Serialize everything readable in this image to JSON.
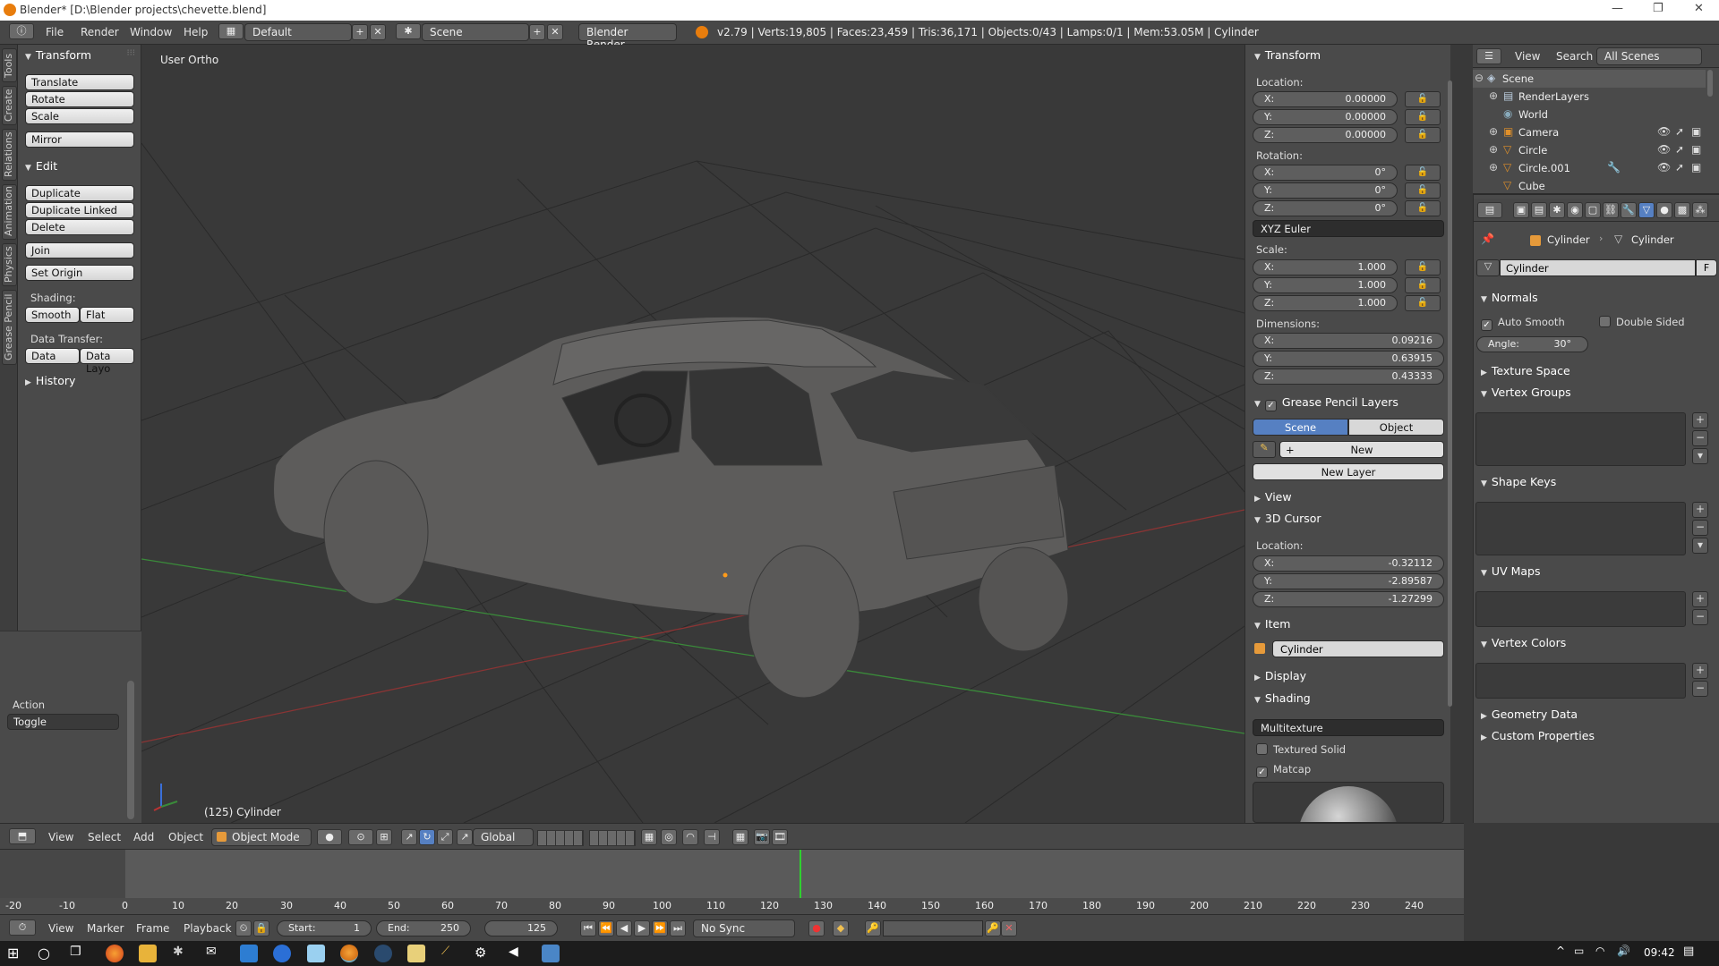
{
  "titlebar": {
    "title": "Blender* [D:\\Blender projects\\chevette.blend]"
  },
  "menu": {
    "file": "File",
    "render": "Render",
    "window": "Window",
    "help": "Help"
  },
  "info": {
    "layout": "Default",
    "scene": "Scene",
    "engine": "Blender Render",
    "stats": "v2.79 | Verts:19,805 | Faces:23,459 | Tris:36,171 | Objects:0/43 | Lamps:0/1 | Mem:53.05M | Cylinder"
  },
  "left_tabs": [
    "Tools",
    "Create",
    "Relations",
    "Animation",
    "Physics",
    "Grease Pencil"
  ],
  "toolshelf": {
    "transform_title": "Transform",
    "translate": "Translate",
    "rotate": "Rotate",
    "scale": "Scale",
    "mirror": "Mirror",
    "edit_title": "Edit",
    "duplicate": "Duplicate",
    "duplicate_linked": "Duplicate Linked",
    "delete": "Delete",
    "join": "Join",
    "set_origin": "Set Origin",
    "shading_label": "Shading:",
    "smooth": "Smooth",
    "flat": "Flat",
    "data_transfer_label": "Data Transfer:",
    "data": "Data",
    "data_layo": "Data Layo",
    "history_title": "History",
    "action_label": "Action",
    "action_value": "Toggle"
  },
  "viewport": {
    "label": "User Ortho",
    "object_info": "(125) Cylinder"
  },
  "npanel": {
    "transform_title": "Transform",
    "location_label": "Location:",
    "loc": {
      "x": "0.00000",
      "y": "0.00000",
      "z": "0.00000"
    },
    "rotation_label": "Rotation:",
    "rot": {
      "x": "0°",
      "y": "0°",
      "z": "0°"
    },
    "rotation_mode": "XYZ Euler",
    "scale_label": "Scale:",
    "scale": {
      "x": "1.000",
      "y": "1.000",
      "z": "1.000"
    },
    "dimensions_label": "Dimensions:",
    "dim": {
      "x": "0.09216",
      "y": "0.63915",
      "z": "0.43333"
    },
    "axis_x": "X:",
    "axis_y": "Y:",
    "axis_z": "Z:",
    "gp_title": "Grease Pencil Layers",
    "gp_scene": "Scene",
    "gp_object": "Object",
    "gp_new": "New",
    "gp_new_layer": "New Layer",
    "view_title": "View",
    "cursor_title": "3D Cursor",
    "cursor_location_label": "Location:",
    "cursor": {
      "x": "-0.32112",
      "y": "-2.89587",
      "z": "-1.27299"
    },
    "item_title": "Item",
    "item_name": "Cylinder",
    "display_title": "Display",
    "shading_title": "Shading",
    "shading_mode": "Multitexture",
    "textured_solid": "Textured Solid",
    "matcap": "Matcap"
  },
  "outliner": {
    "view": "View",
    "search": "Search",
    "scenes_dropdown": "All Scenes",
    "items": [
      "Scene",
      "RenderLayers",
      "World",
      "Camera",
      "Circle",
      "Circle.001",
      "Cube"
    ]
  },
  "properties": {
    "breadcrumb_object": "Cylinder",
    "breadcrumb_data": "Cylinder",
    "mesh_name": "Cylinder",
    "fake_user": "F",
    "normals_title": "Normals",
    "auto_smooth": "Auto Smooth",
    "double_sided": "Double Sided",
    "angle_label": "Angle:",
    "angle_value": "30°",
    "texture_space": "Texture Space",
    "vertex_groups": "Vertex Groups",
    "shape_keys": "Shape Keys",
    "uv_maps": "UV Maps",
    "vertex_colors": "Vertex Colors",
    "geometry_data": "Geometry Data",
    "custom_properties": "Custom Properties"
  },
  "view3d_header": {
    "view": "View",
    "select": "Select",
    "add": "Add",
    "object": "Object",
    "mode": "Object Mode",
    "orientation": "Global"
  },
  "timeline": {
    "ticks": [
      "-20",
      "-10",
      "0",
      "10",
      "20",
      "30",
      "40",
      "50",
      "60",
      "70",
      "80",
      "90",
      "100",
      "110",
      "120",
      "130",
      "140",
      "150",
      "160",
      "170",
      "180",
      "190",
      "200",
      "210",
      "220",
      "230",
      "240"
    ],
    "view": "View",
    "marker": "Marker",
    "frame": "Frame",
    "playback": "Playback",
    "start_label": "Start:",
    "start_value": "1",
    "end_label": "End:",
    "end_value": "250",
    "current_frame": "125",
    "sync": "No Sync"
  },
  "taskbar": {
    "clock": "09:42"
  },
  "colors": {
    "viewport_bg": "#393939",
    "panel_bg": "#4a4a4a",
    "header_bg": "#474747",
    "selected_blue": "#5680c2",
    "grid_red": "#9a3a3a",
    "grid_green": "#3f8a3f",
    "playhead": "#2fd02f"
  }
}
